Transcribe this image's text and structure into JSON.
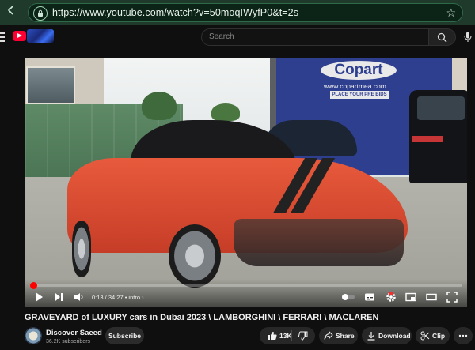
{
  "browser": {
    "url": "https://www.youtube.com/watch?v=50moqIWyfP0&t=2s",
    "bookmark_icon": "star-icon"
  },
  "header": {
    "search_placeholder": "Search",
    "logo_icon": "youtube-logo-icon",
    "doodle_icon": "youtube-doodle-icon"
  },
  "video_frame": {
    "billboard_brand": "Copart",
    "billboard_site": "www.copartmea.com",
    "billboard_tagline": "PLACE YOUR PRE BIDS"
  },
  "player": {
    "current_time": "0:13",
    "duration": "34:27",
    "time_display": "0:13 / 34:27",
    "chapter": "intro",
    "chapter_display": "• intro ›",
    "progress_fraction": 0.0063,
    "hd_badge": "HD",
    "accent_color": "#ff0000"
  },
  "video": {
    "title": "GRAVEYARD of LUXURY cars in Dubai 2023 \\ LAMBORGHINI \\ FERRARI \\ MACLAREN"
  },
  "channel": {
    "name": "Discover Saeed",
    "subscribers": "36.2K subscribers",
    "subscribe_label": "Subscribe"
  },
  "actions": {
    "likes": "13K",
    "share": "Share",
    "download": "Download",
    "clip": "Clip"
  }
}
